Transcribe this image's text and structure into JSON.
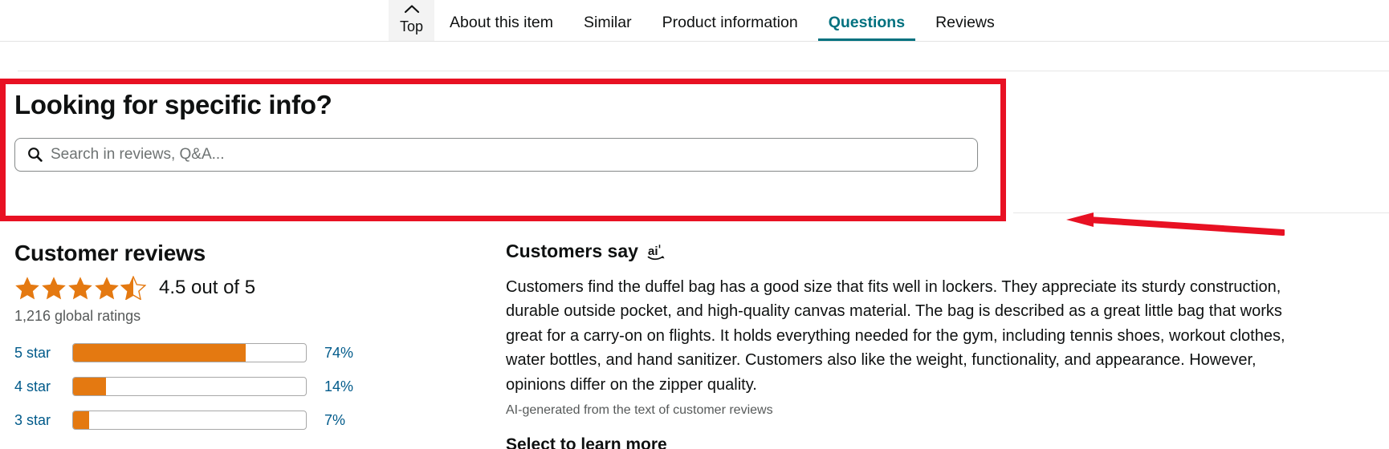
{
  "nav": {
    "tabs": [
      {
        "label": "Top",
        "icon": "chevron-up-icon",
        "active": false,
        "variant": "top"
      },
      {
        "label": "About this item",
        "active": false
      },
      {
        "label": "Similar",
        "active": false
      },
      {
        "label": "Product information",
        "active": false
      },
      {
        "label": "Questions",
        "active": true
      },
      {
        "label": "Reviews",
        "active": false
      }
    ],
    "active_tab_color": "#00717f"
  },
  "specific_info": {
    "title": "Looking for specific info?",
    "search": {
      "placeholder": "Search in reviews, Q&A...",
      "value": "",
      "icon": "search-icon"
    }
  },
  "annotation": {
    "box_color": "#e81123",
    "arrow_color": "#e81123",
    "arrow_direction": "left"
  },
  "customer_reviews": {
    "title": "Customer reviews",
    "rating_value": "4.5",
    "rating_text": "4.5 out of 5",
    "stars_filled": 4,
    "stars_half": 1,
    "stars_total": 5,
    "star_color": "#e47911",
    "global_ratings": "1,216 global ratings",
    "histogram": [
      {
        "label": "5 star",
        "percent": "74%",
        "value": 74
      },
      {
        "label": "4 star",
        "percent": "14%",
        "value": 14
      },
      {
        "label": "3 star",
        "percent": "7%",
        "value": 7
      }
    ],
    "bar_color": "#e47911",
    "link_color": "#005a8a"
  },
  "customers_say": {
    "title": "Customers say",
    "ai_badge": "amazon-ai-icon",
    "summary": "Customers find the duffel bag has a good size that fits well in lockers. They appreciate its sturdy construction, durable outside pocket, and high-quality canvas material. The bag is described as a great little bag that works great for a carry-on on flights. It holds everything needed for the gym, including tennis shoes, workout clothes, water bottles, and hand sanitizer. Customers also like the weight, functionality, and appearance. However, opinions differ on the zipper quality.",
    "caption": "AI-generated from the text of customer reviews",
    "learn_more": "Select to learn more"
  }
}
